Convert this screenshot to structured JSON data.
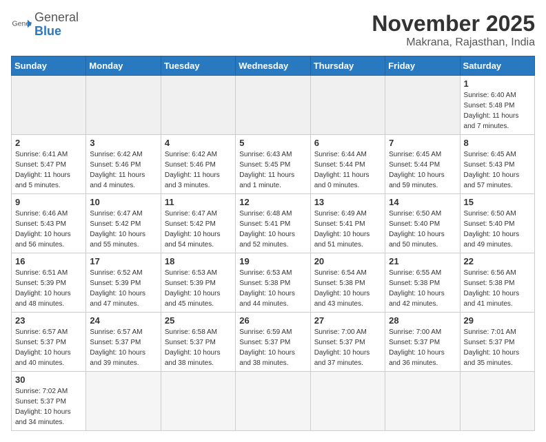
{
  "header": {
    "logo_general": "General",
    "logo_blue": "Blue",
    "month_title": "November 2025",
    "location": "Makrana, Rajasthan, India"
  },
  "days_of_week": [
    "Sunday",
    "Monday",
    "Tuesday",
    "Wednesday",
    "Thursday",
    "Friday",
    "Saturday"
  ],
  "weeks": [
    [
      {
        "day": "",
        "info": ""
      },
      {
        "day": "",
        "info": ""
      },
      {
        "day": "",
        "info": ""
      },
      {
        "day": "",
        "info": ""
      },
      {
        "day": "",
        "info": ""
      },
      {
        "day": "",
        "info": ""
      },
      {
        "day": "1",
        "info": "Sunrise: 6:40 AM\nSunset: 5:48 PM\nDaylight: 11 hours\nand 7 minutes."
      }
    ],
    [
      {
        "day": "2",
        "info": "Sunrise: 6:41 AM\nSunset: 5:47 PM\nDaylight: 11 hours\nand 5 minutes."
      },
      {
        "day": "3",
        "info": "Sunrise: 6:42 AM\nSunset: 5:46 PM\nDaylight: 11 hours\nand 4 minutes."
      },
      {
        "day": "4",
        "info": "Sunrise: 6:42 AM\nSunset: 5:46 PM\nDaylight: 11 hours\nand 3 minutes."
      },
      {
        "day": "5",
        "info": "Sunrise: 6:43 AM\nSunset: 5:45 PM\nDaylight: 11 hours\nand 1 minute."
      },
      {
        "day": "6",
        "info": "Sunrise: 6:44 AM\nSunset: 5:44 PM\nDaylight: 11 hours\nand 0 minutes."
      },
      {
        "day": "7",
        "info": "Sunrise: 6:45 AM\nSunset: 5:44 PM\nDaylight: 10 hours\nand 59 minutes."
      },
      {
        "day": "8",
        "info": "Sunrise: 6:45 AM\nSunset: 5:43 PM\nDaylight: 10 hours\nand 57 minutes."
      }
    ],
    [
      {
        "day": "9",
        "info": "Sunrise: 6:46 AM\nSunset: 5:43 PM\nDaylight: 10 hours\nand 56 minutes."
      },
      {
        "day": "10",
        "info": "Sunrise: 6:47 AM\nSunset: 5:42 PM\nDaylight: 10 hours\nand 55 minutes."
      },
      {
        "day": "11",
        "info": "Sunrise: 6:47 AM\nSunset: 5:42 PM\nDaylight: 10 hours\nand 54 minutes."
      },
      {
        "day": "12",
        "info": "Sunrise: 6:48 AM\nSunset: 5:41 PM\nDaylight: 10 hours\nand 52 minutes."
      },
      {
        "day": "13",
        "info": "Sunrise: 6:49 AM\nSunset: 5:41 PM\nDaylight: 10 hours\nand 51 minutes."
      },
      {
        "day": "14",
        "info": "Sunrise: 6:50 AM\nSunset: 5:40 PM\nDaylight: 10 hours\nand 50 minutes."
      },
      {
        "day": "15",
        "info": "Sunrise: 6:50 AM\nSunset: 5:40 PM\nDaylight: 10 hours\nand 49 minutes."
      }
    ],
    [
      {
        "day": "16",
        "info": "Sunrise: 6:51 AM\nSunset: 5:39 PM\nDaylight: 10 hours\nand 48 minutes."
      },
      {
        "day": "17",
        "info": "Sunrise: 6:52 AM\nSunset: 5:39 PM\nDaylight: 10 hours\nand 47 minutes."
      },
      {
        "day": "18",
        "info": "Sunrise: 6:53 AM\nSunset: 5:39 PM\nDaylight: 10 hours\nand 45 minutes."
      },
      {
        "day": "19",
        "info": "Sunrise: 6:53 AM\nSunset: 5:38 PM\nDaylight: 10 hours\nand 44 minutes."
      },
      {
        "day": "20",
        "info": "Sunrise: 6:54 AM\nSunset: 5:38 PM\nDaylight: 10 hours\nand 43 minutes."
      },
      {
        "day": "21",
        "info": "Sunrise: 6:55 AM\nSunset: 5:38 PM\nDaylight: 10 hours\nand 42 minutes."
      },
      {
        "day": "22",
        "info": "Sunrise: 6:56 AM\nSunset: 5:38 PM\nDaylight: 10 hours\nand 41 minutes."
      }
    ],
    [
      {
        "day": "23",
        "info": "Sunrise: 6:57 AM\nSunset: 5:37 PM\nDaylight: 10 hours\nand 40 minutes."
      },
      {
        "day": "24",
        "info": "Sunrise: 6:57 AM\nSunset: 5:37 PM\nDaylight: 10 hours\nand 39 minutes."
      },
      {
        "day": "25",
        "info": "Sunrise: 6:58 AM\nSunset: 5:37 PM\nDaylight: 10 hours\nand 38 minutes."
      },
      {
        "day": "26",
        "info": "Sunrise: 6:59 AM\nSunset: 5:37 PM\nDaylight: 10 hours\nand 38 minutes."
      },
      {
        "day": "27",
        "info": "Sunrise: 7:00 AM\nSunset: 5:37 PM\nDaylight: 10 hours\nand 37 minutes."
      },
      {
        "day": "28",
        "info": "Sunrise: 7:00 AM\nSunset: 5:37 PM\nDaylight: 10 hours\nand 36 minutes."
      },
      {
        "day": "29",
        "info": "Sunrise: 7:01 AM\nSunset: 5:37 PM\nDaylight: 10 hours\nand 35 minutes."
      }
    ],
    [
      {
        "day": "30",
        "info": "Sunrise: 7:02 AM\nSunset: 5:37 PM\nDaylight: 10 hours\nand 34 minutes."
      },
      {
        "day": "",
        "info": ""
      },
      {
        "day": "",
        "info": ""
      },
      {
        "day": "",
        "info": ""
      },
      {
        "day": "",
        "info": ""
      },
      {
        "day": "",
        "info": ""
      },
      {
        "day": "",
        "info": ""
      }
    ]
  ]
}
